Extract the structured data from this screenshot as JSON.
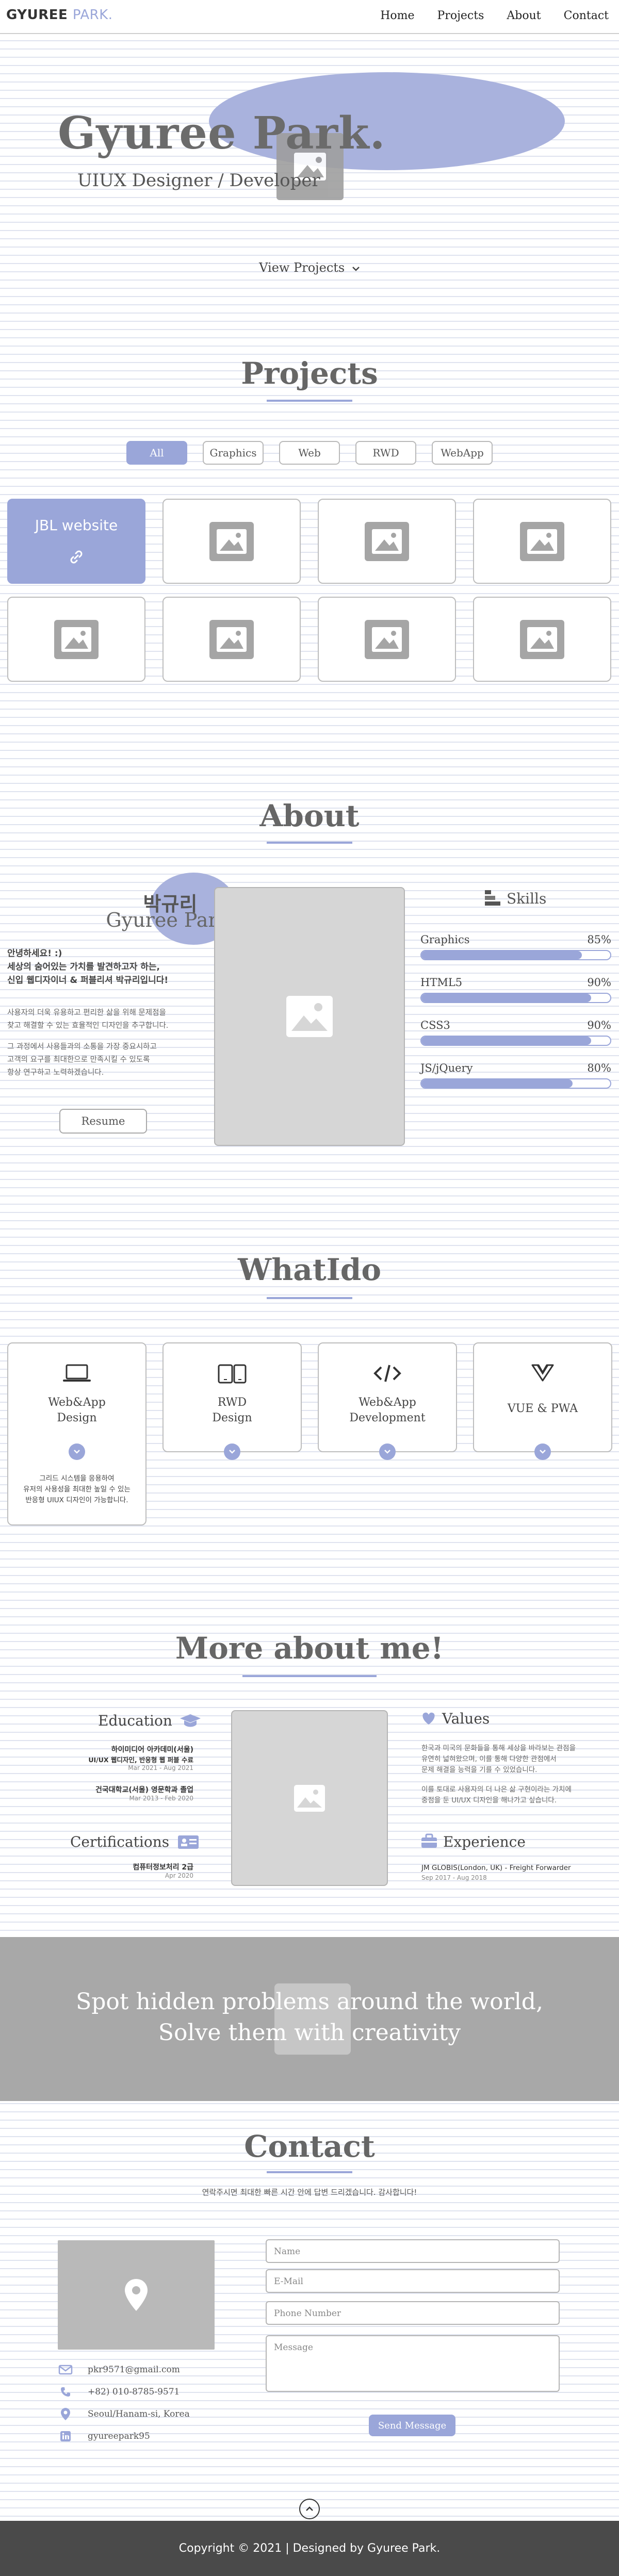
{
  "header": {
    "logo_main": "GYUREE",
    "logo_accent": "PARK.",
    "nav": [
      "Home",
      "Projects",
      "About",
      "Contact"
    ]
  },
  "hero": {
    "name": "Gyuree Park.",
    "role": "UIUX Designer / Developer",
    "view_projects": "View Projects"
  },
  "projects": {
    "title": "Projects",
    "filters": [
      "All",
      "Graphics",
      "Web",
      "RWD",
      "WebApp"
    ],
    "active_filter": "All",
    "featured_title": "JBL website"
  },
  "about": {
    "title": "About",
    "name_kr": "박규리",
    "name_en": "Gyuree Park",
    "intro_lines": [
      "안녕하세요! :)",
      "세상의 숨어있는 가치를 발견하고자 하는,",
      "신입 웹디자이너 & 퍼블리셔 박규리입니다!"
    ],
    "p1_lines": [
      "사용자의 더욱 유용하고 편리한 삶을 위해 문제점을",
      "찾고 해결할 수 있는 효율적인 디자인을 추구합니다."
    ],
    "p2_lines": [
      "그 과정에서 사용들과의 소통을 가장 중요시하고",
      "고객의 요구를 최대한으로 만족시킬 수 있도록",
      "항상 연구하고 노력하겠습니다."
    ],
    "resume_label": "Resume",
    "skills_title": "Skills",
    "skills": [
      {
        "name": "Graphics",
        "percent": "85%",
        "level": 0.85
      },
      {
        "name": "HTML5",
        "percent": "90%",
        "level": 0.9
      },
      {
        "name": "CSS3",
        "percent": "90%",
        "level": 0.9
      },
      {
        "name": "JS/jQuery",
        "percent": "80%",
        "level": 0.8
      }
    ]
  },
  "whatido": {
    "title": "WhatIdo",
    "cards": [
      {
        "icon": "laptop-icon",
        "line1": "Web&App",
        "line2": "Design"
      },
      {
        "icon": "devices-icon",
        "line1": "RWD",
        "line2": "Design"
      },
      {
        "icon": "code-icon",
        "line1": "Web&App",
        "line2": "Development"
      },
      {
        "icon": "vue-icon",
        "line1": "VUE & PWA",
        "line2": ""
      }
    ],
    "desc_lines": [
      "그리드 시스템을 응용하여",
      "유저의 사용성을 최대한 높일 수 있는",
      "반응형 UIUX 디자인이 가능합니다."
    ]
  },
  "more_about": {
    "title": "More about me!",
    "education_title": "Education",
    "education": [
      {
        "title": "하이미디어 아카데미(서울)",
        "subtitle": "UI/UX 웹디자인, 반응형 웹 퍼블 수료",
        "date": "Mar 2021 - Aug 2021"
      },
      {
        "title": "건국대학교(서울) 영문학과 졸업",
        "subtitle": "",
        "date": "Mar 2013 - Feb 2020"
      }
    ],
    "certifications_title": "Certifications",
    "certifications": [
      {
        "title": "컴퓨터정보처리 2급",
        "date": "Apr 2020"
      }
    ],
    "values_title": "Values",
    "values_p1": [
      "한국과 미국의 문화들을 통해 세상을 바라보는 관점을",
      "유연히 넓혀왔으며, 이를 통해 다양한 관점에서",
      "문제 해결을 능력을 기를 수 있었습니다."
    ],
    "values_p2": [
      "이를 토대로 사용자의 더 나은 삶 구현이라는 가치에",
      "중점을 둔 UI/UX 디자인을 해나가고 싶습니다."
    ],
    "experience_title": "Experience",
    "experience_item": "JM GLOBIS(London, UK) - Freight Forwarder",
    "experience_date": "Sep 2017 - Aug 2018"
  },
  "banner": {
    "line1": "Spot hidden problems around the world,",
    "line2": "Solve them with creativity"
  },
  "contact": {
    "title": "Contact",
    "subtitle": "연락주시면 최대한 빠른 시간 안에 답변 드리겠습니다. 감사합니다!",
    "email": "pkr9571@gmail.com",
    "phone": "+82) 010-8785-9571",
    "address": "Seoul/Hanam-si, Korea",
    "linkedin": "gyureepark95",
    "placeholders": {
      "name": "Name",
      "email": "E-Mail",
      "phone": "Phone Number",
      "message": "Message"
    },
    "send_label": "Send Message"
  },
  "footer": {
    "text": "Copyright © 2021 | Designed by Gyuree Park."
  },
  "colors": {
    "accent": "#9aa6d9",
    "footer_bg": "#4a4a4a",
    "banner_bg": "#a8a8a8"
  }
}
